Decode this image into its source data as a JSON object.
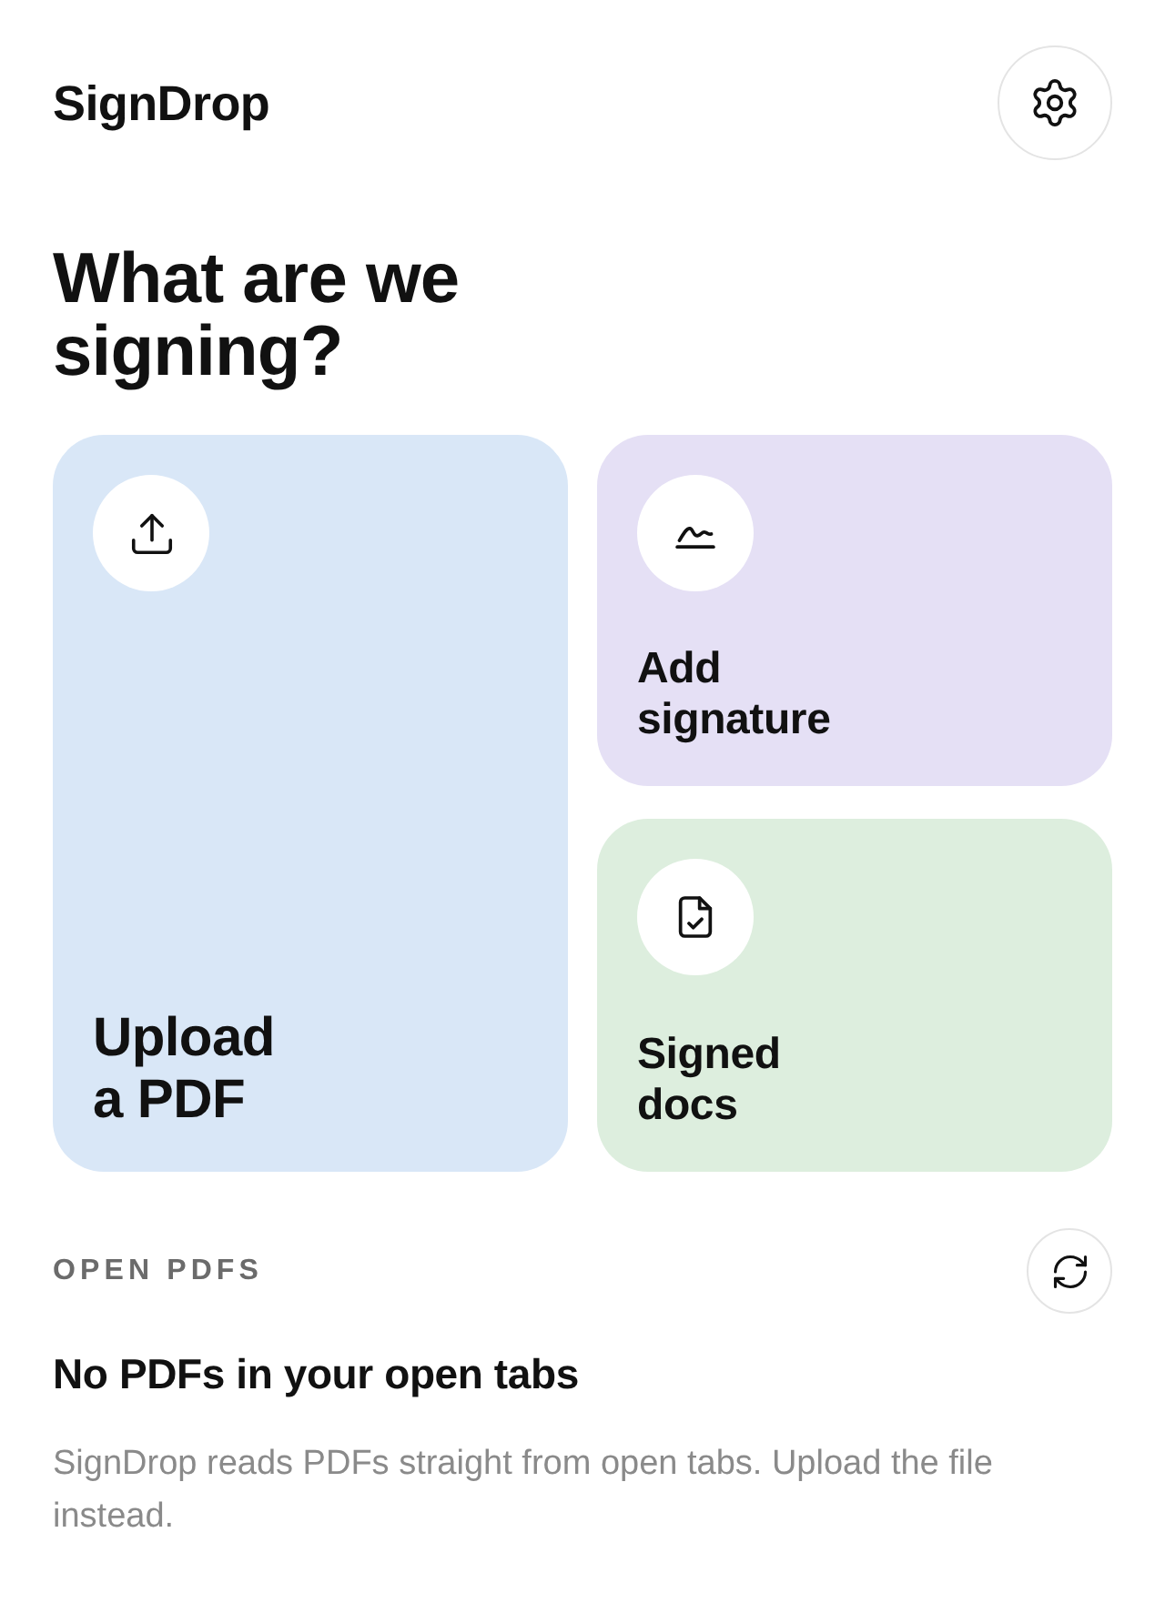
{
  "header": {
    "title": "SignDrop"
  },
  "heading": "What are we signing?",
  "cards": [
    {
      "kind": "upload",
      "label": "Upload a PDF",
      "color": "#d9e7f7"
    },
    {
      "kind": "signature",
      "label": "Add signature",
      "color": "#e5e0f5"
    },
    {
      "kind": "signed",
      "label": "Signed docs",
      "color": "#ddeede"
    }
  ],
  "open_pdfs": {
    "title": "OPEN PDFS",
    "empty_title": "No PDFs in your open tabs",
    "empty_text": "SignDrop reads PDFs straight from open tabs. Upload the file instead."
  }
}
